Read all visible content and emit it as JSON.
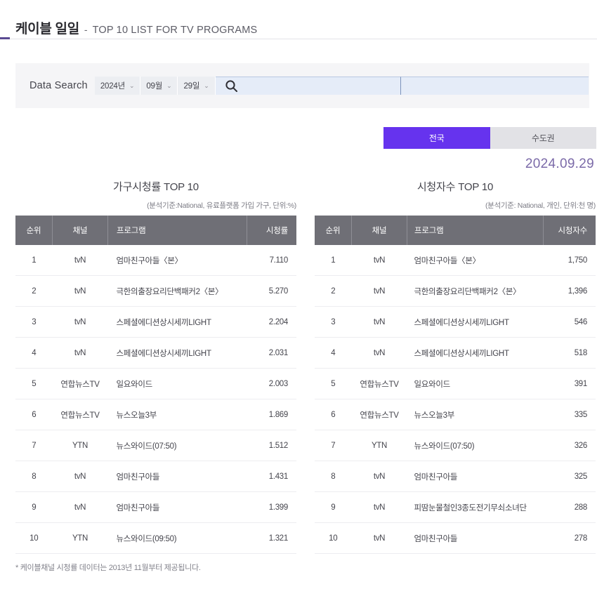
{
  "header": {
    "title_ko": "케이블 일일",
    "dash": "-",
    "title_en": "TOP 10 LIST FOR TV PROGRAMS",
    "accent_color": "#5a4a92"
  },
  "search": {
    "label": "Data Search",
    "year": "2024년",
    "month": "09월",
    "day": "29일",
    "chevron": "⌄",
    "keyword_value": "",
    "keyword_placeholder": "",
    "secondary_value": "",
    "secondary_placeholder": ""
  },
  "region_toggle": {
    "active_label": "전국",
    "inactive_label": "수도권",
    "active_color": "#6633ee",
    "inactive_color": "#e2e2e6"
  },
  "date_display": "2024.09.29",
  "date_color": "#7b6aa8",
  "tables": [
    {
      "key": "household",
      "title": "가구시청률 TOP 10",
      "note": "(분석기준:National, 유료플랫폼 가입 가구, 단위:%)",
      "columns": [
        "순위",
        "채널",
        "프로그램",
        "시청률"
      ],
      "rows": [
        {
          "rank": "1",
          "channel": "tvN",
          "program": "엄마친구아들〈본〉",
          "value": "7.110"
        },
        {
          "rank": "2",
          "channel": "tvN",
          "program": "극한의출장요리단백패커2〈본〉",
          "value": "5.270"
        },
        {
          "rank": "3",
          "channel": "tvN",
          "program": "스페셜에디션상시세끼LIGHT",
          "value": "2.204"
        },
        {
          "rank": "4",
          "channel": "tvN",
          "program": "스페셜에디션상시세끼LIGHT",
          "value": "2.031"
        },
        {
          "rank": "5",
          "channel": "연합뉴스TV",
          "program": "일요와이드",
          "value": "2.003"
        },
        {
          "rank": "6",
          "channel": "연합뉴스TV",
          "program": "뉴스오늘3부",
          "value": "1.869"
        },
        {
          "rank": "7",
          "channel": "YTN",
          "program": "뉴스와이드(07:50)",
          "value": "1.512"
        },
        {
          "rank": "8",
          "channel": "tvN",
          "program": "엄마친구아들",
          "value": "1.431"
        },
        {
          "rank": "9",
          "channel": "tvN",
          "program": "엄마친구아들",
          "value": "1.399"
        },
        {
          "rank": "10",
          "channel": "YTN",
          "program": "뉴스와이드(09:50)",
          "value": "1.321"
        }
      ]
    },
    {
      "key": "viewers",
      "title": "시청자수 TOP 10",
      "note": "(분석기준: National, 개인, 단위:천 명)",
      "columns": [
        "순위",
        "채널",
        "프로그램",
        "시청자수"
      ],
      "rows": [
        {
          "rank": "1",
          "channel": "tvN",
          "program": "엄마친구아들〈본〉",
          "value": "1,750"
        },
        {
          "rank": "2",
          "channel": "tvN",
          "program": "극한의출장요리단백패커2〈본〉",
          "value": "1,396"
        },
        {
          "rank": "3",
          "channel": "tvN",
          "program": "스페셜에디션상시세끼LIGHT",
          "value": "546"
        },
        {
          "rank": "4",
          "channel": "tvN",
          "program": "스페셜에디션상시세끼LIGHT",
          "value": "518"
        },
        {
          "rank": "5",
          "channel": "연합뉴스TV",
          "program": "일요와이드",
          "value": "391"
        },
        {
          "rank": "6",
          "channel": "연합뉴스TV",
          "program": "뉴스오늘3부",
          "value": "335"
        },
        {
          "rank": "7",
          "channel": "YTN",
          "program": "뉴스와이드(07:50)",
          "value": "326"
        },
        {
          "rank": "8",
          "channel": "tvN",
          "program": "엄마친구아들",
          "value": "325"
        },
        {
          "rank": "9",
          "channel": "tvN",
          "program": "피땀눈물철인3종도전기무쇠소녀단",
          "value": "288"
        },
        {
          "rank": "10",
          "channel": "tvN",
          "program": "엄마친구아들",
          "value": "278"
        }
      ]
    }
  ],
  "footnote": "* 케이블채널 시청률 데이터는 2013년 11월부터 제공됩니다.",
  "value_color": "#6a5a8c",
  "table_header_color": "#6f6f76"
}
